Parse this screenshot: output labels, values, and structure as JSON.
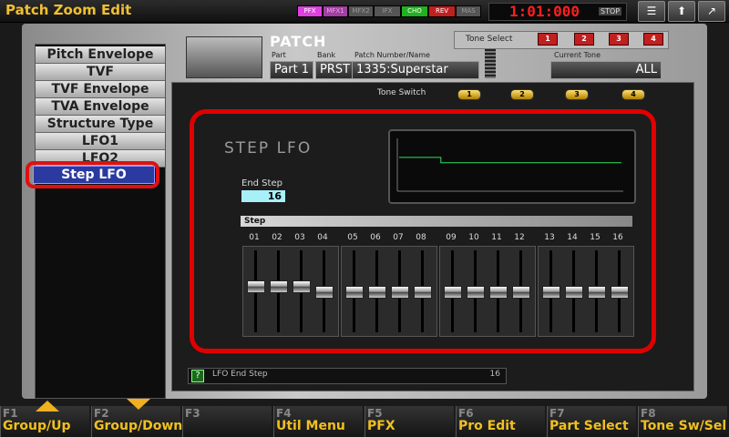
{
  "window": {
    "title": "Patch Zoom Edit"
  },
  "effects": [
    {
      "label": "PFX",
      "bg": "#e040e0",
      "fg": "#ffffff"
    },
    {
      "label": "MFX1",
      "bg": "#a040a0",
      "fg": "#f0a0f0"
    },
    {
      "label": "MFX2",
      "bg": "#555555",
      "fg": "#999999"
    },
    {
      "label": "IFX",
      "bg": "#555555",
      "fg": "#999999"
    },
    {
      "label": "CHO",
      "bg": "#20b020",
      "fg": "#ffffff"
    },
    {
      "label": "REV",
      "bg": "#c02020",
      "fg": "#ffffff"
    },
    {
      "label": "MAS",
      "bg": "#555555",
      "fg": "#999999"
    }
  ],
  "clock": {
    "time": "1:01:000",
    "state": "STOP"
  },
  "top_buttons": [
    "list-icon",
    "up-arrow-icon",
    "export-icon"
  ],
  "sidebar": {
    "items": [
      "Pitch Envelope",
      "TVF",
      "TVF Envelope",
      "TVA Envelope",
      "Structure Type",
      "LFO1",
      "LFO2"
    ],
    "selected": "Step LFO"
  },
  "patch": {
    "label": "PATCH",
    "part_caption": "Part",
    "part": "Part 1",
    "bank_caption": "Bank",
    "bank": "PRST",
    "number_caption": "Patch Number/Name",
    "number": "1335:Superstar",
    "current_tone_caption": "Current Tone",
    "current_tone": "ALL"
  },
  "tone_select": {
    "label": "Tone Select",
    "buttons": [
      "1",
      "2",
      "3",
      "4"
    ]
  },
  "tone_switch": {
    "label": "Tone Switch",
    "buttons": [
      "1",
      "2",
      "3",
      "4"
    ]
  },
  "step_lfo": {
    "title": "STEP LFO",
    "end_step_label": "End Step",
    "end_step": "16",
    "step_header": "Step",
    "steps": [
      "01",
      "02",
      "03",
      "04",
      "05",
      "06",
      "07",
      "08",
      "09",
      "10",
      "11",
      "12",
      "13",
      "14",
      "15",
      "16"
    ],
    "levels": [
      0.58,
      0.58,
      0.58,
      0.5,
      0.5,
      0.5,
      0.5,
      0.5,
      0.5,
      0.5,
      0.5,
      0.5,
      0.5,
      0.5,
      0.5,
      0.5
    ]
  },
  "help": {
    "text": "LFO End Step",
    "value": "16"
  },
  "fkeys": [
    {
      "key": "F1",
      "label": "Group/Up"
    },
    {
      "key": "F2",
      "label": "Group/Down"
    },
    {
      "key": "F3",
      "label": ""
    },
    {
      "key": "F4",
      "label": "Util Menu"
    },
    {
      "key": "F5",
      "label": "PFX"
    },
    {
      "key": "F6",
      "label": "Pro Edit"
    },
    {
      "key": "F7",
      "label": "Part Select"
    },
    {
      "key": "F8",
      "label": "Tone Sw/Sel"
    }
  ]
}
